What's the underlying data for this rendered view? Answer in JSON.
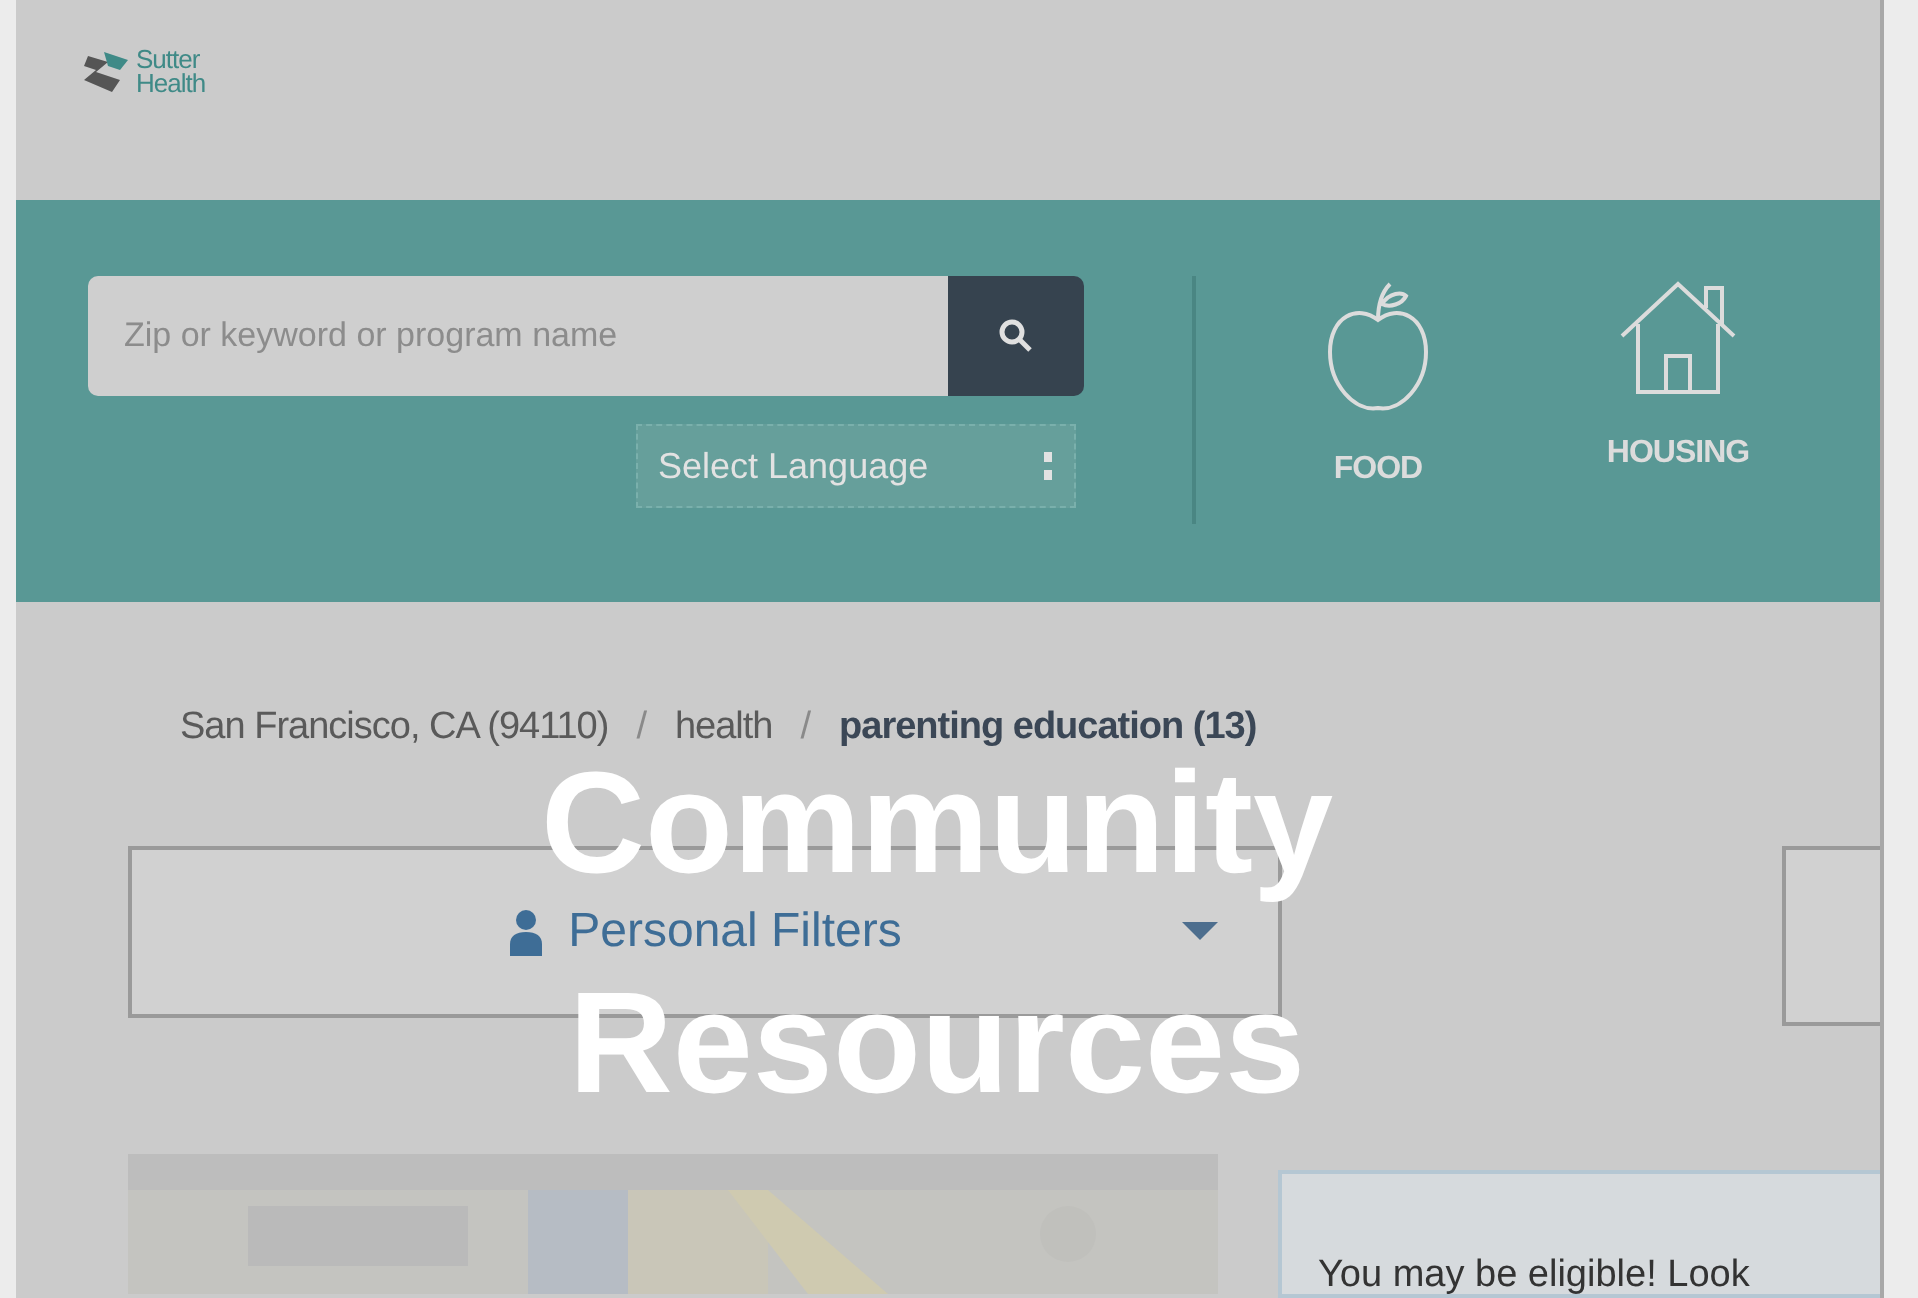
{
  "logo": {
    "line_1": "Sutter",
    "line_2": "Health"
  },
  "search": {
    "placeholder": "Zip or keyword or program name"
  },
  "language_select": {
    "label": "Select Language"
  },
  "categories": [
    {
      "kind": "apple",
      "label": "FOOD"
    },
    {
      "kind": "house",
      "label": "HOUSING"
    }
  ],
  "breadcrumb": [
    {
      "label": "San Francisco, CA (94110)",
      "current": false
    },
    {
      "label": "health",
      "current": false
    },
    {
      "label": "parenting education (13)",
      "current": true
    }
  ],
  "breadcrumb_separator": "/",
  "filters": {
    "label": "Personal Filters"
  },
  "notice": {
    "text": "You may be eligible! Look"
  },
  "overlay_title": {
    "line_1": "Community",
    "line_2": "Resources"
  }
}
